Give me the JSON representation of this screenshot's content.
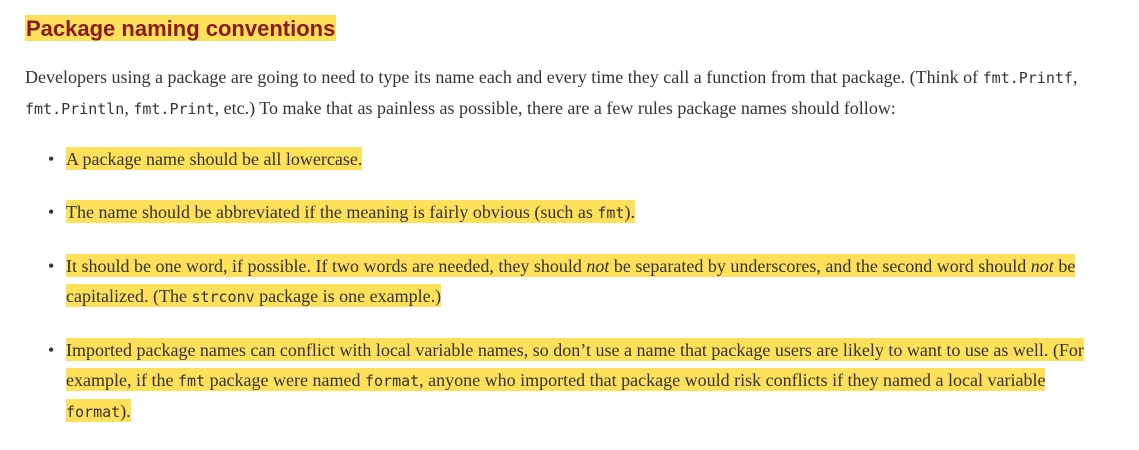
{
  "heading": "Package naming conventions",
  "intro": {
    "text1": "Developers using a package are going to need to type its name each and every time they call a function from that package. (Think of ",
    "code1": "fmt.Printf",
    "text2": ", ",
    "code2": "fmt.Println",
    "text3": ", ",
    "code3": "fmt.Print",
    "text4": ", etc.) To make that as painless as possible, there are a few rules package names should follow:"
  },
  "rules": [
    {
      "text1": "A package name should be all lowercase."
    },
    {
      "text1": "The name should be abbreviated if the meaning is fairly obvious (such as ",
      "code1": "fmt",
      "text2": ")."
    },
    {
      "text1": "It should be one word, if possible. If two words are needed, they should ",
      "em1": "not",
      "text2": " be separated by underscores, and the second word should ",
      "em2": "not",
      "text3": " be capitalized. (The ",
      "code1": "strconv",
      "text4": " package is one example.)"
    },
    {
      "text1": "Imported package names can conflict with local variable names, so don’t use a name that package users are likely to want to use as well. (For example, if the ",
      "code1": "fmt",
      "text2": " package were named ",
      "code2": "format",
      "text3": ", anyone who imported that package would risk conflicts if they named a local variable ",
      "code3": "format",
      "text4": ")."
    }
  ],
  "bullet": "•",
  "colors": {
    "highlight": "#ffe05a",
    "heading_text": "#8b1a1a",
    "body_text": "#333333"
  }
}
